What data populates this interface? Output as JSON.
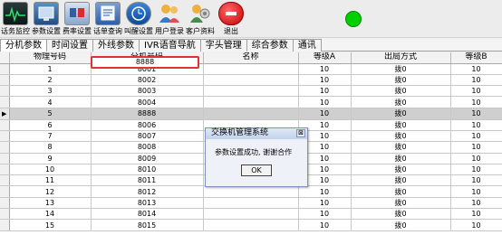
{
  "toolbar": {
    "items": [
      {
        "label": "话务监控",
        "icon": "monitor-icon"
      },
      {
        "label": "参数设置",
        "icon": "settings-icon"
      },
      {
        "label": "费率设置",
        "icon": "rate-icon"
      },
      {
        "label": "话单查询",
        "icon": "query-icon"
      },
      {
        "label": "叫醒设置",
        "icon": "alarm-icon"
      },
      {
        "label": "用户登录",
        "icon": "users-icon"
      },
      {
        "label": "客户资料",
        "icon": "customer-icon"
      },
      {
        "label": "退出",
        "icon": "exit-icon"
      }
    ],
    "status_color": "#00d000"
  },
  "tabs": [
    "分机参数",
    "时间设置",
    "外线参数",
    "IVR语音导航",
    "字头管理",
    "综合参数",
    "通讯"
  ],
  "active_tab": 0,
  "grid": {
    "columns": [
      "物理号码",
      "分机号码",
      "名称",
      "等级A",
      "出局方式",
      "等级B"
    ],
    "rows": [
      [
        "1",
        "8001",
        "",
        "10",
        "拨0",
        "10"
      ],
      [
        "2",
        "8002",
        "",
        "10",
        "拨0",
        "10"
      ],
      [
        "3",
        "8003",
        "",
        "10",
        "拨0",
        "10"
      ],
      [
        "4",
        "8004",
        "",
        "10",
        "拨0",
        "10"
      ],
      [
        "5",
        "8888",
        "",
        "10",
        "拨0",
        "10"
      ],
      [
        "6",
        "8006",
        "",
        "10",
        "拨0",
        "10"
      ],
      [
        "7",
        "8007",
        "",
        "10",
        "拨0",
        "10"
      ],
      [
        "8",
        "8008",
        "",
        "10",
        "拨0",
        "10"
      ],
      [
        "9",
        "8009",
        "",
        "10",
        "拨0",
        "10"
      ],
      [
        "10",
        "8010",
        "",
        "10",
        "拨0",
        "10"
      ],
      [
        "11",
        "8011",
        "",
        "10",
        "拨0",
        "10"
      ],
      [
        "12",
        "8012",
        "",
        "10",
        "拨0",
        "10"
      ],
      [
        "13",
        "8013",
        "",
        "10",
        "拨0",
        "10"
      ],
      [
        "14",
        "8014",
        "",
        "10",
        "拨0",
        "10"
      ],
      [
        "15",
        "8015",
        "",
        "10",
        "拨0",
        "10"
      ]
    ],
    "current_row": 4,
    "editing_value": "8888"
  },
  "dialog": {
    "title": "交换机管理系统",
    "message": "参数设置成功, 谢谢合作",
    "ok_label": "OK"
  }
}
